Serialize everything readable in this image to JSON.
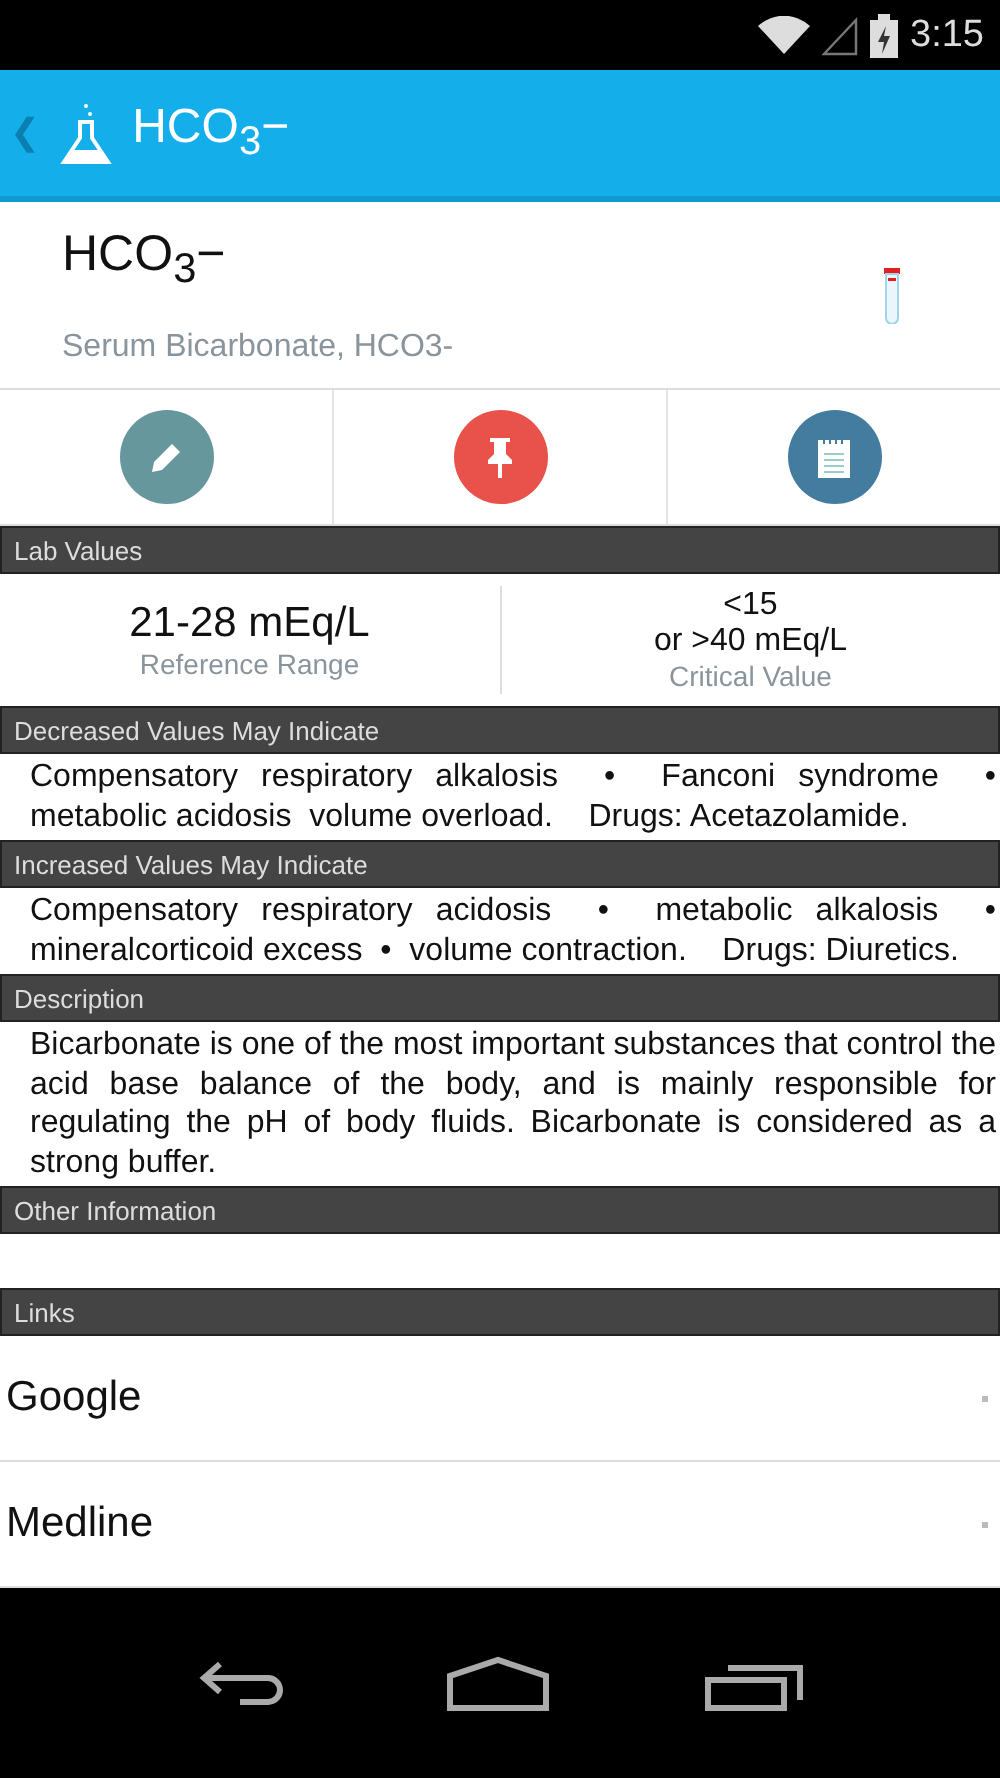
{
  "status_bar": {
    "time": "3:15"
  },
  "app_bar": {
    "back": "❮",
    "title": "HCO$_{3}$−"
  },
  "header": {
    "name": "HCO$_{3}$−",
    "subtitle": "Serum Bicarbonate, HCO3-"
  },
  "actions": [
    {
      "kind": "edit",
      "color": "#65979c"
    },
    {
      "kind": "pin",
      "color": "#e9524a"
    },
    {
      "kind": "notes",
      "color": "#447ca0"
    }
  ],
  "sections": [
    {
      "kind": "values",
      "title": "Lab Values",
      "values": [
        {
          "value": "21-28 mEq/L",
          "label": "Reference Range"
        },
        {
          "value": "<15\nor >40 mEq/L",
          "label": "Critical Value"
        }
      ]
    },
    {
      "kind": "text",
      "title": "Decreased Values May Indicate",
      "text": "Compensatory respiratory alkalosis  •  Fanconi syndrome  •  metabolic acidosis  volume overload.    Drugs: Acetazolamide."
    },
    {
      "kind": "text",
      "title": "Increased Values May Indicate",
      "text": "Compensatory respiratory acidosis  •  metabolic alkalosis  •  mineralcorticoid excess  •  volume contraction.    Drugs: Diuretics."
    },
    {
      "kind": "text",
      "title": "Description",
      "text": "Bicarbonate is one of the most important substances that control the acid base balance of the body, and is mainly responsible for regulating the pH of body fluids. Bicarbonate is considered as a strong buffer."
    },
    {
      "kind": "empty",
      "title": "Other Information"
    },
    {
      "kind": "links",
      "title": "Links",
      "links": [
        "Google",
        "Medline"
      ]
    }
  ]
}
